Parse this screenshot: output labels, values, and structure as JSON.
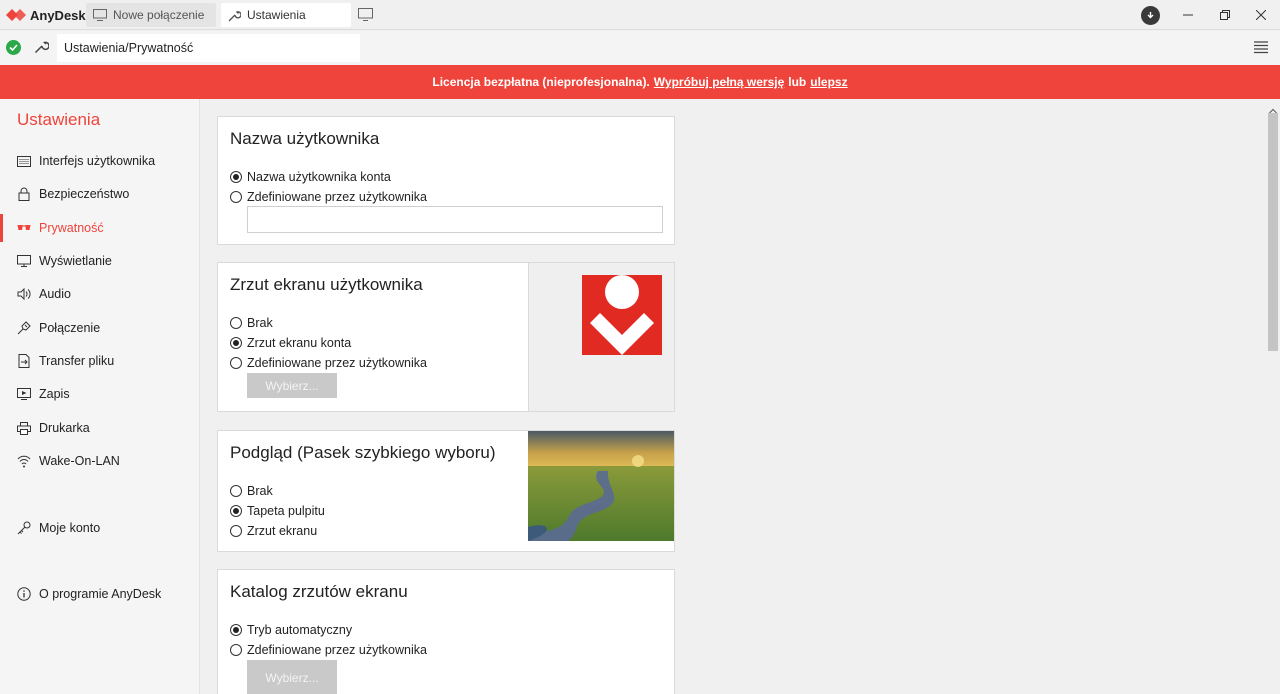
{
  "app": {
    "name": "AnyDesk",
    "brand_color": "#ef443b"
  },
  "tabs": [
    {
      "label": "Nowe połączenie",
      "icon": "monitor-icon"
    },
    {
      "label": "Ustawienia",
      "icon": "wrench-icon"
    }
  ],
  "address": {
    "path": "Ustawienia/Prywatność",
    "status": "connected"
  },
  "banner": {
    "text": "Licencja bezpłatna (nieprofesjonalna).",
    "link1": "Wypróbuj pełną wersję",
    "mid": "lub",
    "link2": "ulepsz"
  },
  "sidebar": {
    "title": "Ustawienia",
    "items": [
      {
        "label": "Interfejs użytkownika",
        "icon": "keyboard-icon"
      },
      {
        "label": "Bezpieczeństwo",
        "icon": "lock-icon"
      },
      {
        "label": "Prywatność",
        "icon": "glasses-icon",
        "active": true
      },
      {
        "label": "Wyświetlanie",
        "icon": "display-icon"
      },
      {
        "label": "Audio",
        "icon": "speaker-icon"
      },
      {
        "label": "Połączenie",
        "icon": "plug-icon"
      },
      {
        "label": "Transfer pliku",
        "icon": "file-transfer-icon"
      },
      {
        "label": "Zapis",
        "icon": "record-icon"
      },
      {
        "label": "Drukarka",
        "icon": "printer-icon"
      },
      {
        "label": "Wake-On-LAN",
        "icon": "wifi-icon"
      }
    ],
    "account": {
      "label": "Moje konto",
      "icon": "key-icon"
    },
    "about": {
      "label": "O programie AnyDesk",
      "icon": "info-icon"
    }
  },
  "sections": {
    "username": {
      "title": "Nazwa użytkownika",
      "options": [
        "Nazwa użytkownika konta",
        "Zdefiniowane przez użytkownika"
      ],
      "selected": 0,
      "input_value": ""
    },
    "screenshot": {
      "title": "Zrzut ekranu użytkownika",
      "options": [
        "Brak",
        "Zrzut ekranu konta",
        "Zdefiniowane przez użytkownika"
      ],
      "selected": 1,
      "button": "Wybierz..."
    },
    "preview": {
      "title": "Podgląd (Pasek szybkiego wyboru)",
      "options": [
        "Brak",
        "Tapeta pulpitu",
        "Zrzut ekranu"
      ],
      "selected": 1
    },
    "catalog": {
      "title": "Katalog zrzutów ekranu",
      "options": [
        "Tryb automatyczny",
        "Zdefiniowane przez użytkownika"
      ],
      "selected": 0,
      "button": "Wybierz..."
    }
  }
}
